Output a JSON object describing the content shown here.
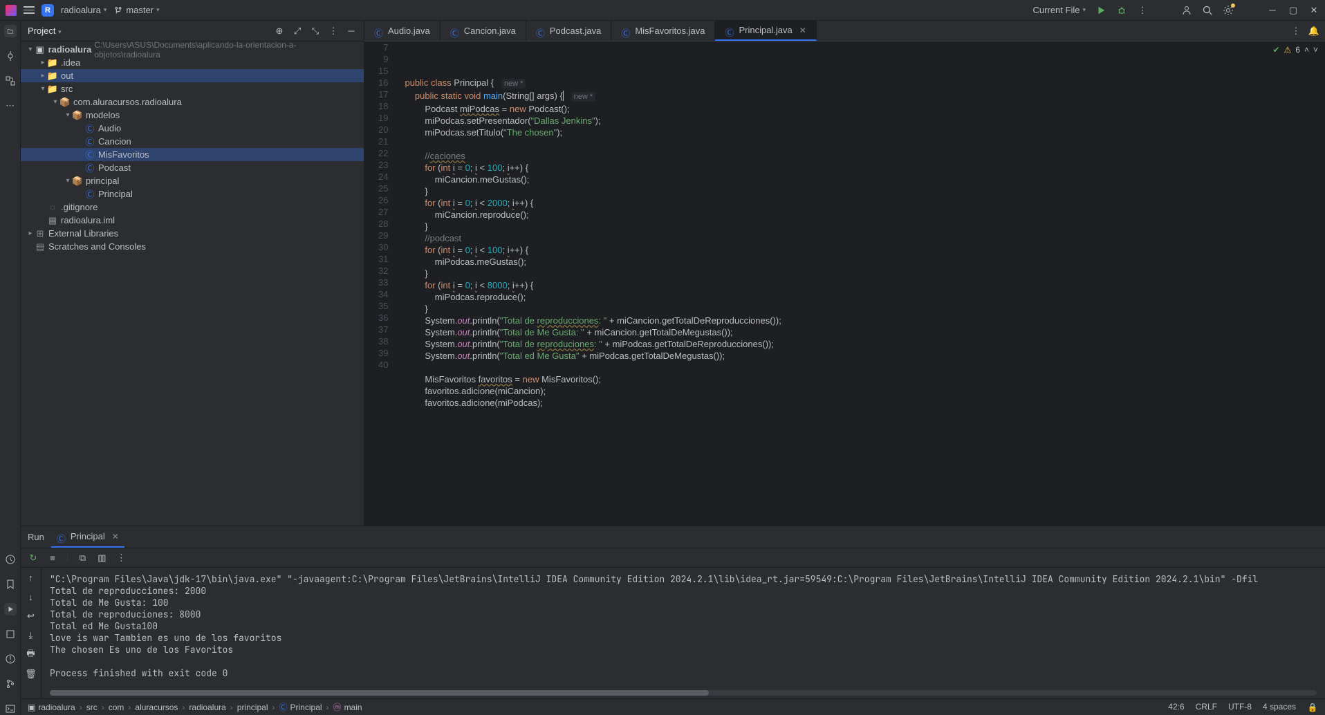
{
  "titlebar": {
    "project_badge": "R",
    "project_name": "radioalura",
    "branch": "master",
    "run_config": "Current File"
  },
  "project_panel": {
    "title": "Project",
    "root": "radioalura",
    "root_path": "C:\\Users\\ASUS\\Documents\\aplicando-la-orientacion-a-objetos\\radioalura",
    "nodes": {
      "idea": ".idea",
      "out": "out",
      "src": "src",
      "pkg": "com.aluracursos.radioalura",
      "modelos": "modelos",
      "audio": "Audio",
      "cancion": "Cancion",
      "misfav": "MisFavoritos",
      "podcast": "Podcast",
      "principal_pkg": "principal",
      "principal_cls": "Principal",
      "gitignore": ".gitignore",
      "iml": "radioalura.iml",
      "ext": "External Libraries",
      "scratch": "Scratches and Consoles"
    }
  },
  "tabs": {
    "t1": "Audio.java",
    "t2": "Cancion.java",
    "t3": "Podcast.java",
    "t4": "MisFavoritos.java",
    "t5": "Principal.java"
  },
  "problems_count": "6",
  "code": {
    "lines": [
      {
        "n": 7,
        "html": "<span class='kw'>public class</span> Principal {   <span class='hint'>new *</span>"
      },
      {
        "n": 9,
        "html": "    <span class='kw'>public static void</span> <span class='mth'>main</span>(String[] args) {<span class='caret'></span>   <span class='hint'>new *</span>"
      },
      {
        "n": 15,
        "html": "        Podcast <span class='warn'>miPodcas</span> = <span class='kw'>new</span> Podcast();"
      },
      {
        "n": 16,
        "html": "        miPodcas.setPresentador(<span class='str'>\"Dallas Jenkins\"</span>);"
      },
      {
        "n": 17,
        "html": "        miPodcas.setTitulo(<span class='str'>\"The chosen\"</span>);"
      },
      {
        "n": 18,
        "html": ""
      },
      {
        "n": 19,
        "html": "        <span class='cmt'>//</span><span class='cmt warn'>caciones</span>"
      },
      {
        "n": 20,
        "html": "        <span class='kw'>for</span> (<span class='kw'>int</span> <span class='warn'>i</span> = <span class='num'>0</span>; <span class='warn'>i</span> &lt; <span class='num'>100</span>; <span class='warn'>i</span>++) {"
      },
      {
        "n": 21,
        "html": "            miCancion.meGustas();"
      },
      {
        "n": 22,
        "html": "        }"
      },
      {
        "n": 23,
        "html": "        <span class='kw'>for</span> (<span class='kw'>int</span> <span class='warn'>i</span> = <span class='num'>0</span>; <span class='warn'>i</span> &lt; <span class='num'>2000</span>; <span class='warn'>i</span>++) {"
      },
      {
        "n": 24,
        "html": "            miCancion.reproduce();"
      },
      {
        "n": 25,
        "html": "        }"
      },
      {
        "n": 26,
        "html": "        <span class='cmt'>//podcast</span>"
      },
      {
        "n": 27,
        "html": "        <span class='kw'>for</span> (<span class='kw'>int</span> <span class='warn'>i</span> = <span class='num'>0</span>; <span class='warn'>i</span> &lt; <span class='num'>100</span>; <span class='warn'>i</span>++) {"
      },
      {
        "n": 28,
        "html": "            miPodcas.meGustas();"
      },
      {
        "n": 29,
        "html": "        }"
      },
      {
        "n": 30,
        "html": "        <span class='kw'>for</span> (<span class='kw'>int</span> <span class='warn'>i</span> = <span class='num'>0</span>; <span class='warn'>i</span> &lt; <span class='num'>8000</span>; <span class='warn'>i</span>++) {"
      },
      {
        "n": 31,
        "html": "            miPodcas.reproduce();"
      },
      {
        "n": 32,
        "html": "        }"
      },
      {
        "n": 33,
        "html": "        System.<span class='fld'>out</span>.println(<span class='str'>\"Total de </span><span class='str warn'>reproducciones</span><span class='str'>: \"</span> + miCancion.getTotalDeReproducciones());"
      },
      {
        "n": 34,
        "html": "        System.<span class='fld'>out</span>.println(<span class='str'>\"Total de Me Gusta: \"</span> + miCancion.getTotalDeMegustas());"
      },
      {
        "n": 35,
        "html": "        System.<span class='fld'>out</span>.println(<span class='str'>\"Total de </span><span class='str warn'>reproduciones</span><span class='str'>: \"</span> + miPodcas.getTotalDeReproducciones());"
      },
      {
        "n": 36,
        "html": "        System.<span class='fld'>out</span>.println(<span class='str'>\"Total ed Me Gusta\"</span> + miPodcas.getTotalDeMegustas());"
      },
      {
        "n": 37,
        "html": ""
      },
      {
        "n": 38,
        "html": "        MisFavoritos <span class='warn'>favoritos</span> = <span class='kw'>new</span> MisFavoritos();"
      },
      {
        "n": 39,
        "html": "        favoritos.adicione(miCancion);"
      },
      {
        "n": 40,
        "html": "        favoritos.adicione(miPodcas);"
      }
    ]
  },
  "run": {
    "label": "Run",
    "config": "Principal",
    "output": "\"C:\\Program Files\\Java\\jdk-17\\bin\\java.exe\" \"-javaagent:C:\\Program Files\\JetBrains\\IntelliJ IDEA Community Edition 2024.2.1\\lib\\idea_rt.jar=59549:C:\\Program Files\\JetBrains\\IntelliJ IDEA Community Edition 2024.2.1\\bin\" -Dfil\nTotal de reproducciones: 2000\nTotal de Me Gusta: 100\nTotal de reproduciones: 8000\nTotal ed Me Gusta100\nlove is war Tambien es uno de los favoritos\nThe chosen Es uno de los Favoritos\n\nProcess finished with exit code 0"
  },
  "breadcrumbs": [
    "radioalura",
    "src",
    "com",
    "aluracursos",
    "radioalura",
    "principal",
    "Principal",
    "main"
  ],
  "statusbar": {
    "pos": "42:6",
    "eol": "CRLF",
    "enc": "UTF-8",
    "indent": "4 spaces"
  }
}
